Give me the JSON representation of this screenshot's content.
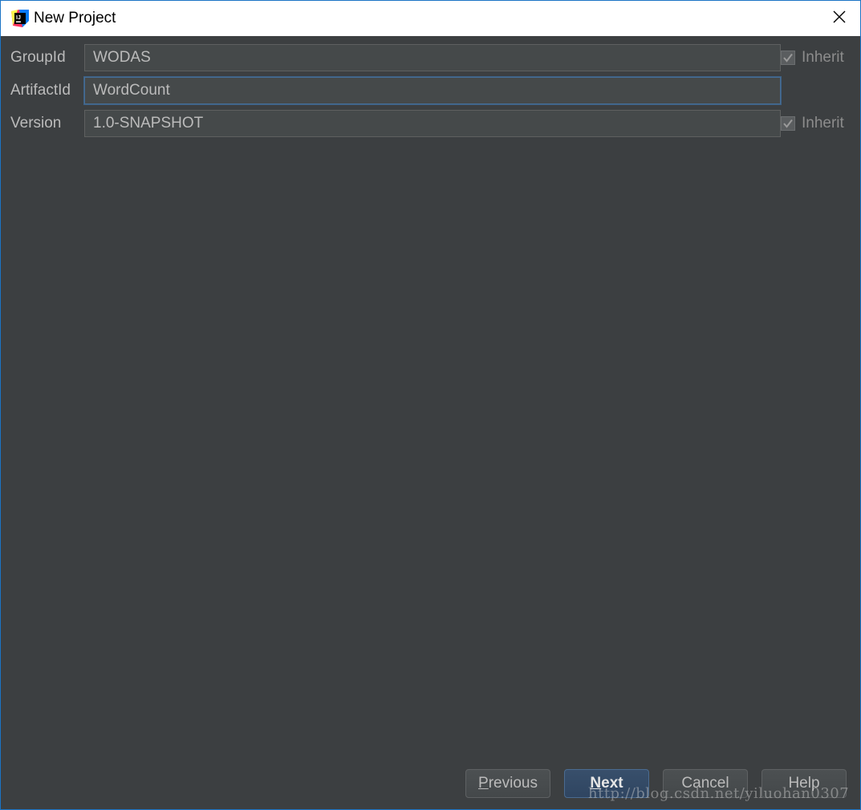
{
  "window": {
    "title": "New Project",
    "accent": "#1b74c5"
  },
  "icons": {
    "app": "intellij-idea-icon",
    "close": "close-icon",
    "check": "checkmark-icon"
  },
  "form": {
    "group_id": {
      "label": "GroupId",
      "value": "WODAS",
      "inherit_label": "Inherit",
      "inherit_checked": true
    },
    "artifact_id": {
      "label": "ArtifactId",
      "value": "WordCount"
    },
    "version": {
      "label": "Version",
      "value": "1.0-SNAPSHOT",
      "inherit_label": "Inherit",
      "inherit_checked": true
    }
  },
  "buttons": {
    "previous": {
      "mnemonic": "P",
      "rest": "revious"
    },
    "next": {
      "mnemonic": "N",
      "rest": "ext"
    },
    "cancel": "Cancel",
    "help": "Help"
  },
  "watermark": "http://blog.csdn.net/yiluohan0307"
}
